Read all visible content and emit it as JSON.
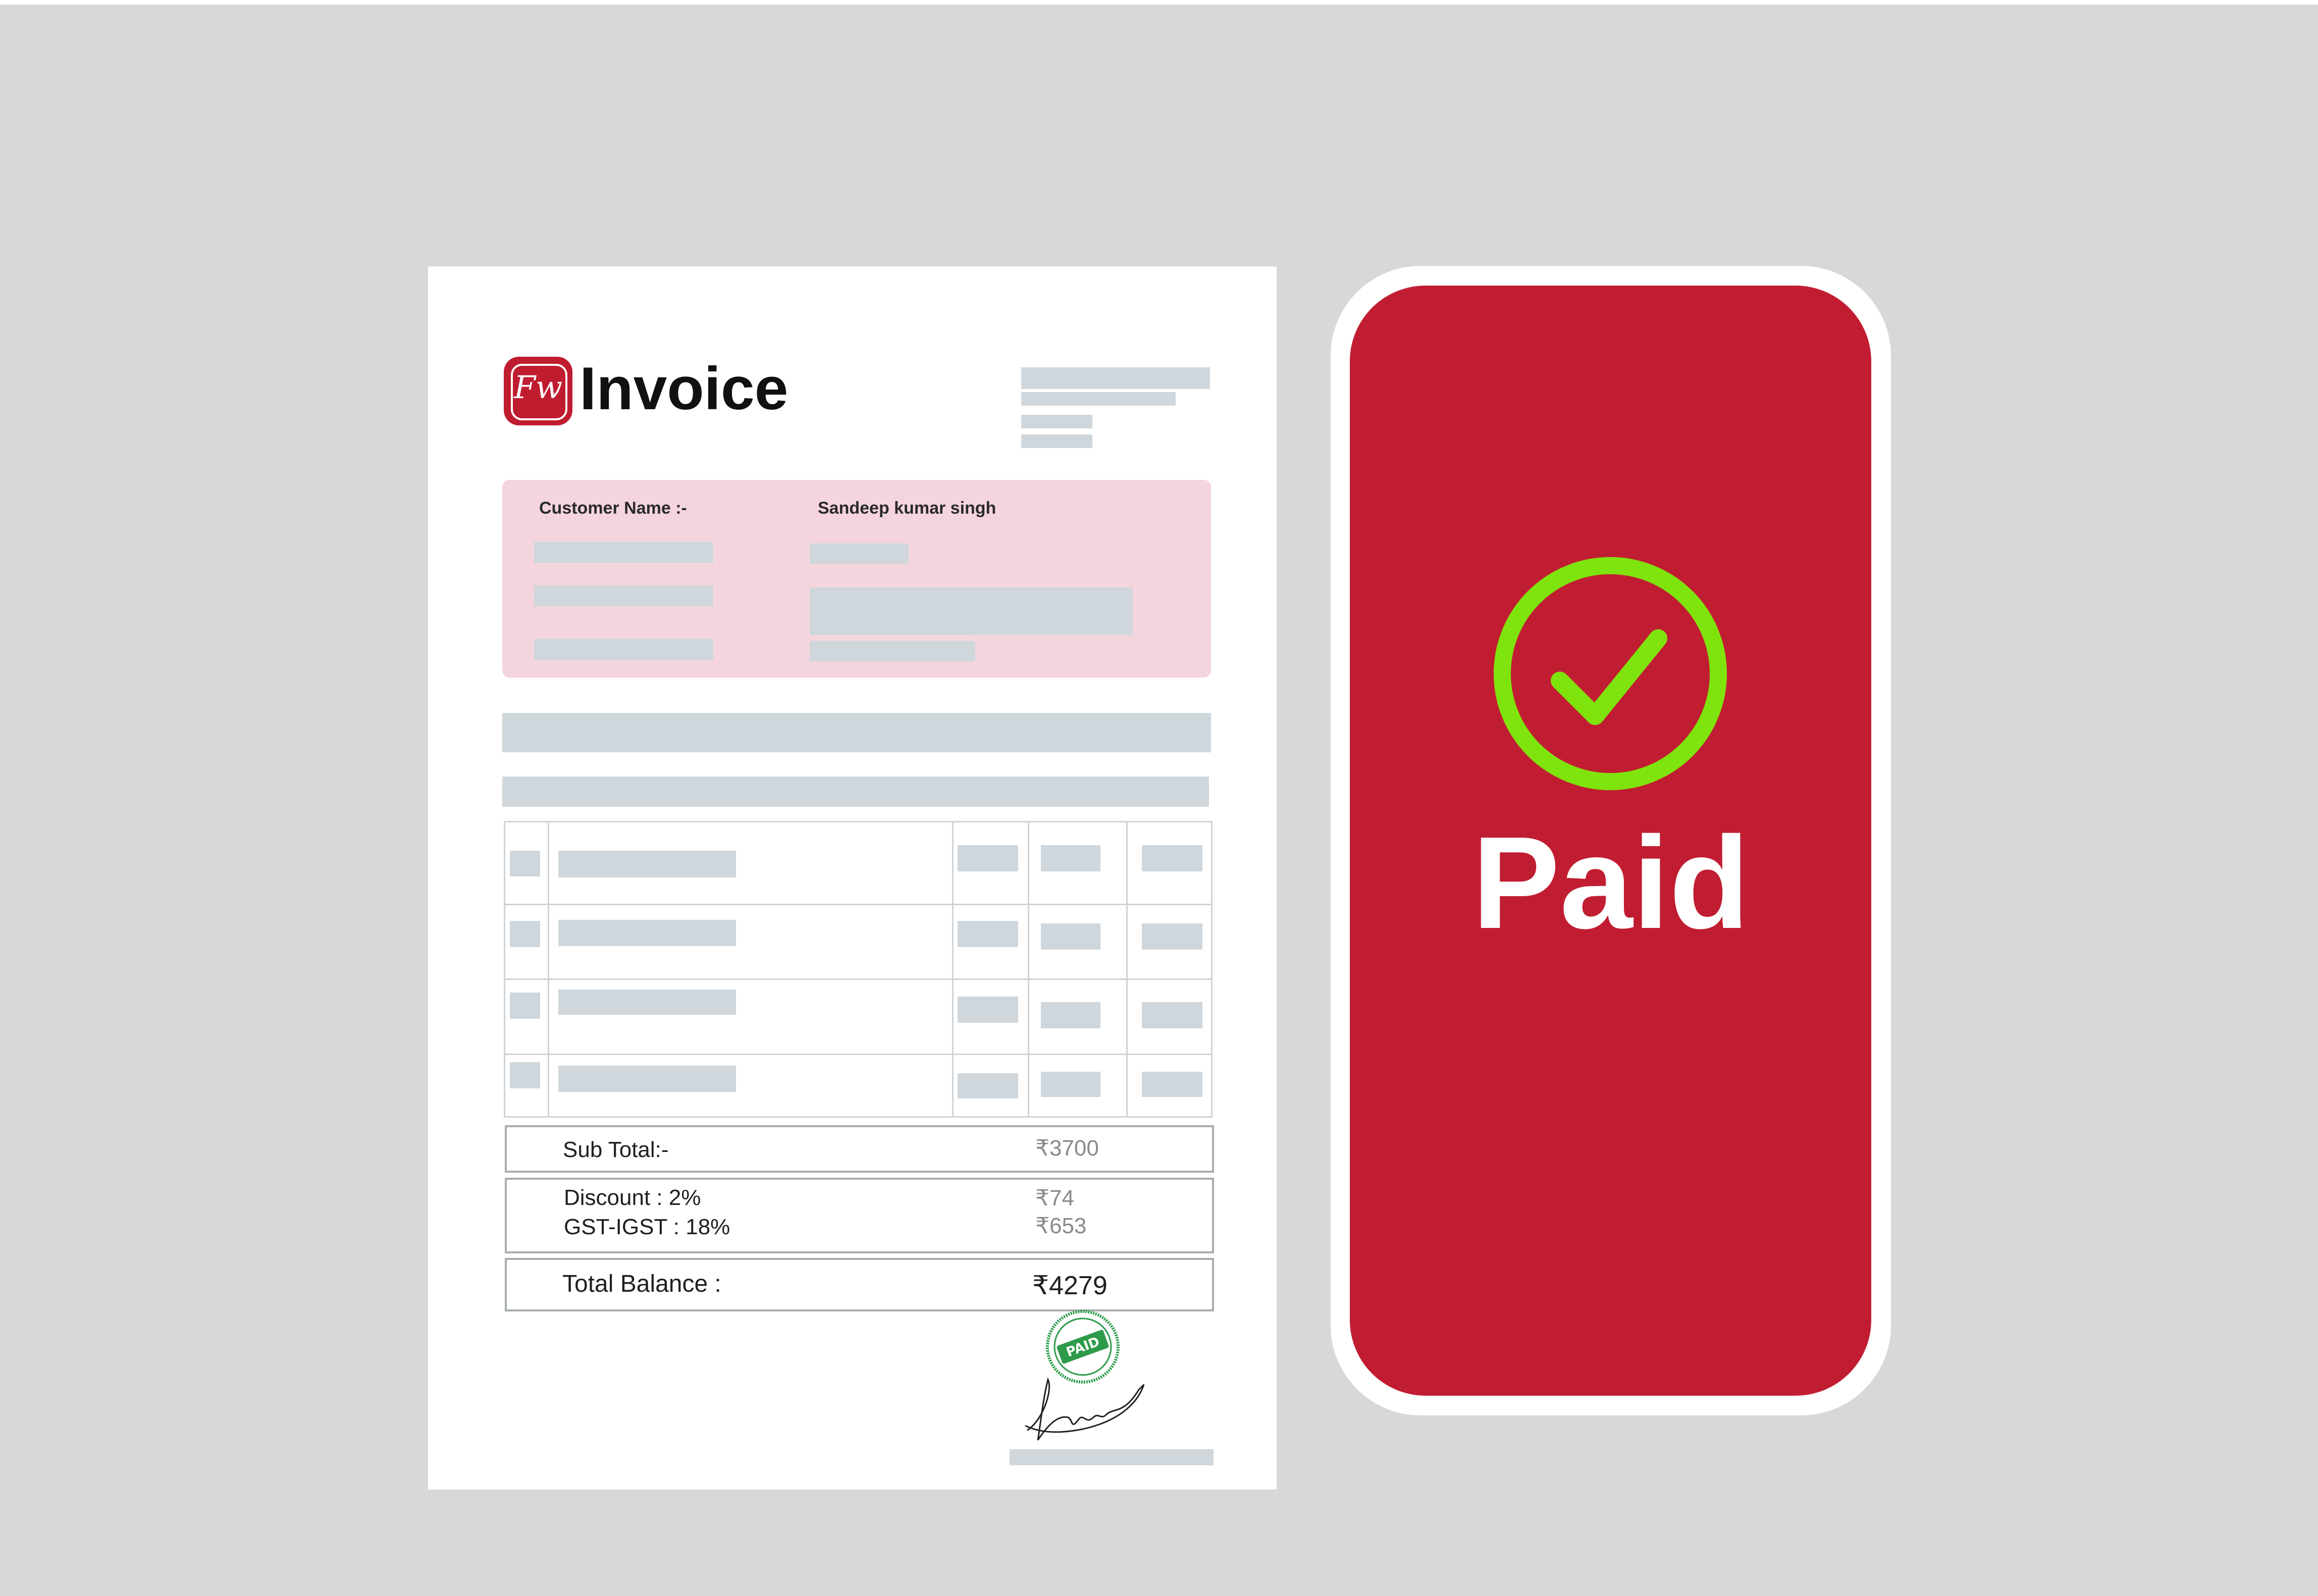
{
  "invoice": {
    "logo_monogram": "Fw",
    "title": "Invoice",
    "customer_label": "Customer Name :-",
    "customer_name": "Sandeep kumar singh",
    "sub_total_label": "Sub Total:-",
    "sub_total_value": "₹3700",
    "discount_label": "Discount : 2%",
    "discount_value": "₹74",
    "gst_label": "GST-IGST : 18%",
    "gst_value": "₹653",
    "total_label": "Total Balance :",
    "total_value": "₹4279",
    "stamp_text": "PAID"
  },
  "phone": {
    "status_text": "Paid",
    "status_icon": "check-circle-icon"
  },
  "colors": {
    "brand_red": "#c11d32",
    "check_green": "#7fe30d",
    "customer_box_pink": "#f5d5dd",
    "placeholder_gray": "#cfd7dc",
    "stamp_green": "#2e9b4a"
  }
}
